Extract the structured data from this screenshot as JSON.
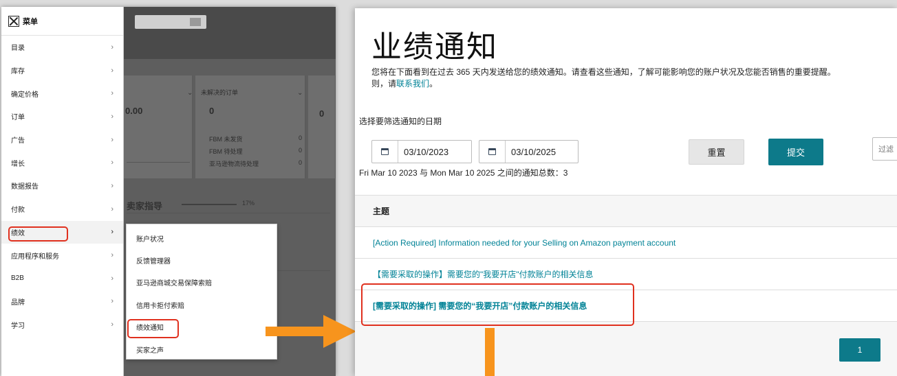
{
  "menu": {
    "title": "菜单",
    "items": [
      {
        "label": "目录"
      },
      {
        "label": "库存"
      },
      {
        "label": "确定价格"
      },
      {
        "label": "订单"
      },
      {
        "label": "广告"
      },
      {
        "label": "增长"
      },
      {
        "label": "数据报告"
      },
      {
        "label": "付款"
      },
      {
        "label": "绩效"
      },
      {
        "label": "应用程序和服务"
      },
      {
        "label": "B2B"
      },
      {
        "label": "品牌"
      },
      {
        "label": "学习"
      }
    ],
    "chevron": "›"
  },
  "submenu": {
    "items": [
      {
        "label": "账户状况"
      },
      {
        "label": "反馈管理器"
      },
      {
        "label": "亚马逊商城交易保障索赔"
      },
      {
        "label": "信用卡拒付索赔"
      },
      {
        "label": "绩效通知"
      },
      {
        "label": "买家之声"
      }
    ]
  },
  "dashboard": {
    "unresolved_orders": "未解决的订单",
    "value_left": "0.00",
    "value_right": "0",
    "value_far": "0",
    "fbm_unshipped": "FBM 未发货",
    "fbm_pending": "FBM 待处理",
    "amazon_pending": "亚马逊物流待处理",
    "zero": "0",
    "seller_guide": "卖家指导",
    "percent": "17%"
  },
  "page": {
    "title": "业绩通知",
    "description_line1": "您将在下面看到在过去 365 天内发送给您的绩效通知。请查看这些通知，了解可能影响您的账户状况及您能否销售的重要提醒。",
    "description_line2_prefix": "则，请",
    "contact_link": "联系我们",
    "description_line2_suffix": "。",
    "filter_label": "选择要筛选通知的日期",
    "date_from": "03/10/2023",
    "date_to": "03/10/2025",
    "reset_label": "重置",
    "submit_label": "提交",
    "filter_placeholder": "过滤",
    "count_text": "Fri Mar 10 2023 与 Mon Mar 10 2025 之间的通知总数：3"
  },
  "table": {
    "header": "主题",
    "rows": [
      {
        "subject": "[Action Required] Information needed for your Selling on Amazon payment account"
      },
      {
        "subject": "【需要采取的操作】需要您的\"我要开店\"付款账户的相关信息"
      },
      {
        "subject": "[需要采取的操作] 需要您的“我要开店”付款账户的相关信息"
      }
    ],
    "page_number": "1"
  },
  "colors": {
    "accent_teal": "#0d7a8a",
    "link_teal": "#008296",
    "highlight_red": "#e0301e",
    "arrow_orange": "#f7941d"
  }
}
